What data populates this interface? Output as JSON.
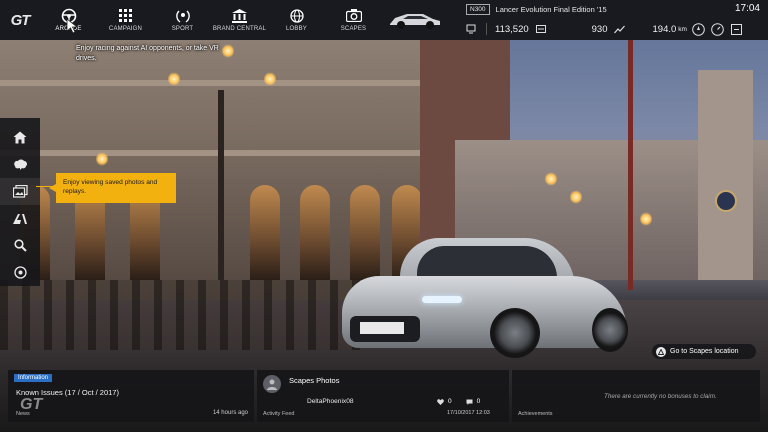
{
  "brand": {
    "logo_text": "GT"
  },
  "nav": {
    "items": [
      {
        "id": "arcade",
        "label": "ARCADE",
        "icon": "steering-wheel-icon"
      },
      {
        "id": "campaign",
        "label": "CAMPAIGN",
        "icon": "grid-icon"
      },
      {
        "id": "sport",
        "label": "SPORT",
        "icon": "laurel-icon"
      },
      {
        "id": "brand-central",
        "label": "BRAND CENTRAL",
        "icon": "building-icon"
      },
      {
        "id": "lobby",
        "label": "LOBBY",
        "icon": "globe-icon"
      },
      {
        "id": "scapes",
        "label": "SCAPES",
        "icon": "camera-icon"
      }
    ],
    "arcade_tooltip": "Enjoy racing against AI opponents, or take VR drives."
  },
  "status": {
    "car_class": "N300",
    "car_name": "Lancer Evolution Final Edition '15",
    "clock": "17:04",
    "credits": "113,520",
    "mileage_points": "930",
    "distance": "194.0",
    "distance_unit": "km"
  },
  "sidebar": {
    "items": [
      {
        "id": "home",
        "icon": "home-icon"
      },
      {
        "id": "tuning",
        "icon": "brain-icon"
      },
      {
        "id": "gallery",
        "icon": "photos-icon"
      },
      {
        "id": "gt-auto",
        "icon": "gt-auto-icon"
      },
      {
        "id": "search",
        "icon": "search-icon"
      },
      {
        "id": "options",
        "icon": "disc-icon"
      }
    ],
    "tooltip": "Enjoy viewing saved photos and replays."
  },
  "scapes_button": {
    "label": "Go to Scapes location"
  },
  "news": {
    "tag": "Information",
    "title": "Known Issues (17 / Oct / 2017)",
    "time": "14 hours ago",
    "footer": "News"
  },
  "feed": {
    "title": "Scapes Photos",
    "user": "DeltaPhoenix08",
    "likes": "0",
    "comments": "0",
    "date": "17/10/2017 12:03",
    "footer": "Activity Feed"
  },
  "achievements": {
    "empty_text": "There are currently no bonuses to claim.",
    "footer": "Achievements"
  },
  "colors": {
    "accent_yellow": "#f3b10f",
    "info_blue": "#2a6fc4",
    "bar_bg": "#121216"
  }
}
